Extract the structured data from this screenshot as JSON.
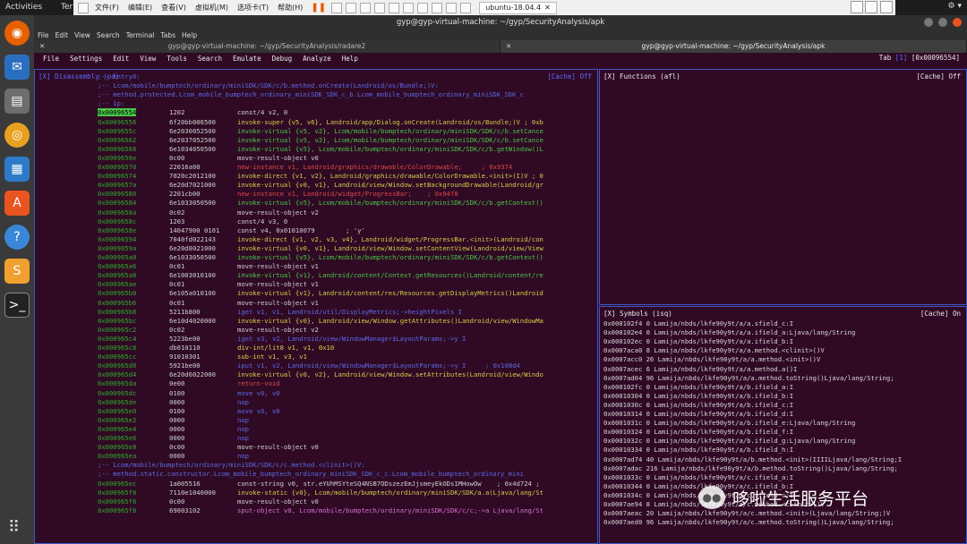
{
  "topbar": {
    "activities": "Activities",
    "term_short": "Ter",
    "vm_menus": [
      "文件(F)",
      "编辑(E)",
      "查看(V)",
      "虚拟机(M)",
      "选项卡(T)",
      "帮助(H)"
    ],
    "vm_tab": "ubuntu-18.04.4"
  },
  "window": {
    "title": "gyp@gyp-virtual-machine: ~/gyp/SecurityAnalysis/apk"
  },
  "terminal_menu": [
    "File",
    "Edit",
    "View",
    "Search",
    "Terminal",
    "Tabs",
    "Help"
  ],
  "tabs": [
    {
      "label": "gyp@gyp-virtual-machine: ~/gyp/SecurityAnalysis/radare2"
    },
    {
      "label": "gyp@gyp-virtual-machine: ~/gyp/SecurityAnalysis/apk"
    }
  ],
  "r2": {
    "menu": [
      "File",
      "Settings",
      "Edit",
      "View",
      "Tools",
      "Search",
      "Emulate",
      "Debug",
      "Analyze",
      "Help"
    ],
    "tab_indicator": "Tab",
    "tab_index": "1",
    "seek": "[0x00096554]",
    "disasm_title": "[X] Disassembly (pd)",
    "disasm_cache": "[Cache] Off",
    "functions_title": "[X]   Functions (afl)",
    "functions_cache": "[Cache] Off",
    "symbols_title": "[X]   Symbols (isq)",
    "symbols_cache": "[Cache] On",
    "header_lines": [
      ";-- entry0:",
      ";-- Lcom/mobile/bumptech/ordinary/miniSDK/SDK/c/b.method.onCreate(Landroid/os/Bundle;)V:",
      ";-- method.protected.Lcom_mobile_bumptech_ordinary_miniSDK_SDK_c_b.Lcom_mobile_bumptech_ordinary_miniSDK_SDK_c",
      ";-- ip:"
    ],
    "disasm": [
      {
        "addr": "0x00096554",
        "bytes": "1202",
        "op": "const/4 v2, 0",
        "c": "op"
      },
      {
        "addr": "0x00096556",
        "bytes": "6f20bb006500",
        "op": "invoke-super {v5, v6}, Landroid/app/Dialog.onCreate(Landroid/os/Bundle;)V ; 0xb",
        "c": "gy"
      },
      {
        "addr": "0x0009655c",
        "bytes": "6e2030052500",
        "op": "invoke-virtual {v5, v2}, Lcom/mobile/bumptech/ordinary/miniSDK/SDK/c/b.setCance",
        "c": "g"
      },
      {
        "addr": "0x00096562",
        "bytes": "6e2037052500",
        "op": "invoke-virtual {v5, v2}, Lcom/mobile/bumptech/ordinary/miniSDK/SDK/c/b.setCance",
        "c": "g"
      },
      {
        "addr": "0x00096568",
        "bytes": "6e1034050500",
        "op": "invoke-virtual {v5}, Lcom/mobile/bumptech/ordinary/miniSDK/SDK/c/b.getWindow()L",
        "c": "g"
      },
      {
        "addr": "0x0009656e",
        "bytes": "0c00",
        "op": "move-result-object v0",
        "c": "op"
      },
      {
        "addr": "0x00096570",
        "bytes": "22016a00",
        "op": "new-instance v1, Landroid/graphics/drawable/ColorDrawable;     ; 0x9374",
        "c": "r"
      },
      {
        "addr": "0x00096574",
        "bytes": "7020c2012100",
        "op": "invoke-direct {v1, v2}, Landroid/graphics/drawable/ColorDrawable.<init>(I)V ; 0",
        "c": "gy"
      },
      {
        "addr": "0x0009657a",
        "bytes": "6e20d7021000",
        "op": "invoke-virtual {v0, v1}, Landroid/view/Window.setBackgroundDrawable(Landroid/gr",
        "c": "gy"
      },
      {
        "addr": "0x00096580",
        "bytes": "2201cb00",
        "op": "new-instance v1, Landroid/widget/ProgressBar;    ; 0x94f8",
        "c": "r"
      },
      {
        "addr": "0x00096584",
        "bytes": "6e1033050500",
        "op": "invoke-virtual {v5}, Lcom/mobile/bumptech/ordinary/miniSDK/SDK/c/b.getContext()",
        "c": "g"
      },
      {
        "addr": "0x0009658a",
        "bytes": "0c02",
        "op": "move-result-object v2",
        "c": "op"
      },
      {
        "addr": "0x0009658c",
        "bytes": "1203",
        "op": "const/4 v3, 0",
        "c": "op"
      },
      {
        "addr": "0x0009658e",
        "bytes": "14047900 0101",
        "op": "const v4, 0x01010079        ; 'y'",
        "c": "op"
      },
      {
        "addr": "0x00096594",
        "bytes": "7040fd022143",
        "op": "invoke-direct {v1, v2, v3, v4}, Landroid/widget/ProgressBar.<init>(Landroid/con",
        "c": "gy"
      },
      {
        "addr": "0x0009659a",
        "bytes": "6e20d8021000",
        "op": "invoke-virtual {v0, v1}, Landroid/view/Window.setContentView(Landroid/view/View",
        "c": "gy"
      },
      {
        "addr": "0x000965a0",
        "bytes": "6e1033050500",
        "op": "invoke-virtual {v5}, Lcom/mobile/bumptech/ordinary/miniSDK/SDK/c/b.getContext()",
        "c": "g"
      },
      {
        "addr": "0x000965a6",
        "bytes": "0c01",
        "op": "move-result-object v1",
        "c": "op"
      },
      {
        "addr": "0x000965a8",
        "bytes": "6e1003010100",
        "op": "invoke-virtual {v1}, Landroid/content/Context.getResources()Landroid/content/re",
        "c": "g"
      },
      {
        "addr": "0x000965ae",
        "bytes": "0c01",
        "op": "move-result-object v1",
        "c": "op"
      },
      {
        "addr": "0x000965b0",
        "bytes": "6e105a010100",
        "op": "invoke-virtual {v1}, Landroid/content/res/Resources.getDisplayMetrics()Landroid",
        "c": "gy"
      },
      {
        "addr": "0x000965b6",
        "bytes": "0c01",
        "op": "move-result-object v1",
        "c": "op"
      },
      {
        "addr": "0x000965b8",
        "bytes": "5211b800",
        "op": "iget v1, v1, Landroid/util/DisplayMetrics;->heightPixels I",
        "c": "bl"
      },
      {
        "addr": "0x000965bc",
        "bytes": "6e10d4020000",
        "op": "invoke-virtual {v0}, Landroid/view/Window.getAttributes()Landroid/view/WindowMa",
        "c": "gy"
      },
      {
        "addr": "0x000965c2",
        "bytes": "0c02",
        "op": "move-result-object v2",
        "c": "op"
      },
      {
        "addr": "0x000965c4",
        "bytes": "5223be00",
        "op": "iget v3, v2, Landroid/view/WindowManager$LayoutParams;->y I",
        "c": "bl"
      },
      {
        "addr": "0x000965c8",
        "bytes": "db010110",
        "op": "div-int/lit8 v1, v1, 0x10",
        "c": "y"
      },
      {
        "addr": "0x000965cc",
        "bytes": "91010301",
        "op": "sub-int v1, v3, v1",
        "c": "y"
      },
      {
        "addr": "0x000965d0",
        "bytes": "5921be00",
        "op": "iput v1, v2, Landroid/view/WindowManager$LayoutParams;->y I     ; 0x108d4",
        "c": "bl"
      },
      {
        "addr": "0x000965d4",
        "bytes": "6e20d6022000",
        "op": "invoke-virtual {v0, v2}, Landroid/view/Window.setAttributes(Landroid/view/Windo",
        "c": "gy"
      },
      {
        "addr": "0x000965da",
        "bytes": "0e00",
        "op": "return-void",
        "c": "r"
      },
      {
        "addr": "0x000965dc",
        "bytes": "0100",
        "op": "move v0, v0",
        "c": "bl"
      },
      {
        "addr": "0x000965de",
        "bytes": "0000",
        "op": "nop",
        "c": "bl"
      },
      {
        "addr": "0x000965e0",
        "bytes": "0100",
        "op": "move v0, v0",
        "c": "bl"
      },
      {
        "addr": "0x000965e2",
        "bytes": "0000",
        "op": "nop",
        "c": "bl"
      },
      {
        "addr": "0x000965e4",
        "bytes": "0000",
        "op": "nop",
        "c": "bl"
      },
      {
        "addr": "0x000965e6",
        "bytes": "0000",
        "op": "nop",
        "c": "bl"
      },
      {
        "addr": "0x000965e8",
        "bytes": "0c00",
        "op": "move-result-object v0",
        "c": "op"
      },
      {
        "addr": "0x000965ea",
        "bytes": "0000",
        "op": "nop",
        "c": "bl"
      }
    ],
    "footer_comments": [
      ";-- Lcom/mobile/bumptech/ordinary/miniSDK/SDK/c/c.method.<clinit>()V:",
      ";-- method.static.constructor.Lcom_mobile_bumptech_ordinary_miniSDK_SDK_c_c.Lcom_mobile_bumptech_ordinary_mini"
    ],
    "disasm_tail": [
      {
        "addr": "0x000965ec",
        "bytes": "1a005516",
        "op": "const-string v0, str.eYUhMSYteSQ4NSB7ODszezEmJjsmeyEkODs1MHowOw    ; 0x4d724 ;",
        "c": "op"
      },
      {
        "addr": "0x000965f0",
        "bytes": "7110e1040000",
        "op": "invoke-static {v0}, Lcom/mobile/bumptech/ordinary/miniSDK/SDK/a.a(Ljava/lang/St",
        "c": "gy"
      },
      {
        "addr": "0x000965f6",
        "bytes": "0c00",
        "op": "move-result-object v0",
        "c": "op"
      },
      {
        "addr": "0x000965f8",
        "bytes": "69003102",
        "op": "sput-object v0, Lcom/mobile/bumptech/ordinary/miniSDK/SDK/c/c;->a Ljava/lang/St",
        "c": "mg"
      }
    ],
    "symbols": [
      "0x000102f4 0 Lamija/nbds/lkfe90y9t/a/a.sfield_c:I",
      "0x000102e4 0 Lamija/nbds/lkfe90y9t/a/a.ifield_a:Ljava/lang/String",
      "0x000102ec 0 Lamija/nbds/lkfe90y9t/a/a.ifield_b:I",
      "0x0007aca0 8 Lamija/nbds/lkfe90y9t/a/a.method.<clinit>()V",
      "0x0007acc0 26 Lamija/nbds/lkfe90y9t/a/a.method.<init>()V",
      "0x0007acec 6 Lamija/nbds/lkfe90y9t/a/a.method.a()I",
      "0x0007ad04 96 Lamija/nbds/lkfe90y9t/a/a.method.toString()Ljava/lang/String;",
      "0x000102fc 0 Lamija/nbds/lkfe90y9t/a/b.ifield_a:I",
      "0x00010304 0 Lamija/nbds/lkfe90y9t/a/b.ifield_b:I",
      "0x0001030c 0 Lamija/nbds/lkfe90y9t/a/b.ifield_c:I",
      "0x00010314 0 Lamija/nbds/lkfe90y9t/a/b.ifield_d:I",
      "0x0001031c 0 Lamija/nbds/lkfe90y9t/a/b.ifield_e:Ljava/lang/String",
      "0x00010324 0 Lamija/nbds/lkfe90y9t/a/b.ifield_f:I",
      "0x0001032c 0 Lamija/nbds/lkfe90y9t/a/b.ifield_g:Ljava/lang/String",
      "0x00010334 0 Lamija/nbds/lkfe90y9t/a/b.ifield_h:I",
      "0x0007ad74 40 Lamija/nbds/lkfe90y9t/a/b.method.<init>(IIIILjava/lang/String;I",
      "0x0007adac 216 Lamija/nbds/lkfe90y9t/a/b.method.toString()Ljava/lang/String;",
      "0x0001033c 0 Lamija/nbds/lkfe90y9t/a/c.ifield_a:I",
      "0x00010344 0 Lamija/nbds/lkfe90y9t/a/c.ifield_b:I",
      "0x0001034c 0 Lamija/nbds/lkfe90y9t/a/c.ifield_c:I",
      "0x0007ae94 8 Lamija/nbds/lkfe90y9t/a/c.method.<clinit>()V",
      "0x0007aeac 20 Lamija/nbds/lkfe90y9t/a/c.method.<init>(Ljava/lang/String;)V",
      "0x0007aed0 96 Lamija/nbds/lkfe90y9t/a/c.method.toString()Ljava/lang/String;"
    ]
  },
  "watermark": "哆啦生活服务平台"
}
